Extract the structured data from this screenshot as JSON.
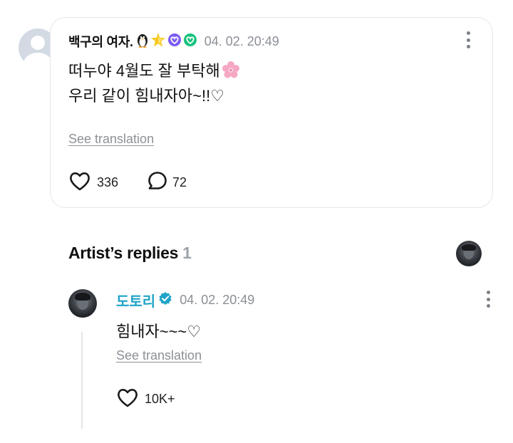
{
  "comment": {
    "author": "백구의 여자.",
    "timestamp": "04. 02. 20:49",
    "lines": [
      "떠누야 4월도 잘 부탁해",
      "우리 같이 힘내자아~!!♡"
    ],
    "emoji_icons": [
      "penguin-emoji",
      "star-emoji",
      "purple-heart-badge",
      "green-heart-badge"
    ],
    "flower_icon": "cherry-blossom-emoji",
    "see_translation": "See translation",
    "likes": "336",
    "replies": "72"
  },
  "artist_replies": {
    "title": "Artist’s replies",
    "count": "1"
  },
  "reply": {
    "author": "도토리",
    "timestamp": "04. 02. 20:49",
    "text": "힘내자~~~♡",
    "see_translation": "See translation",
    "likes": "10K+"
  },
  "colors": {
    "artist_name": "#1fa3c8",
    "muted_text": "#8b8f96",
    "card_border": "#e3e6ea"
  }
}
